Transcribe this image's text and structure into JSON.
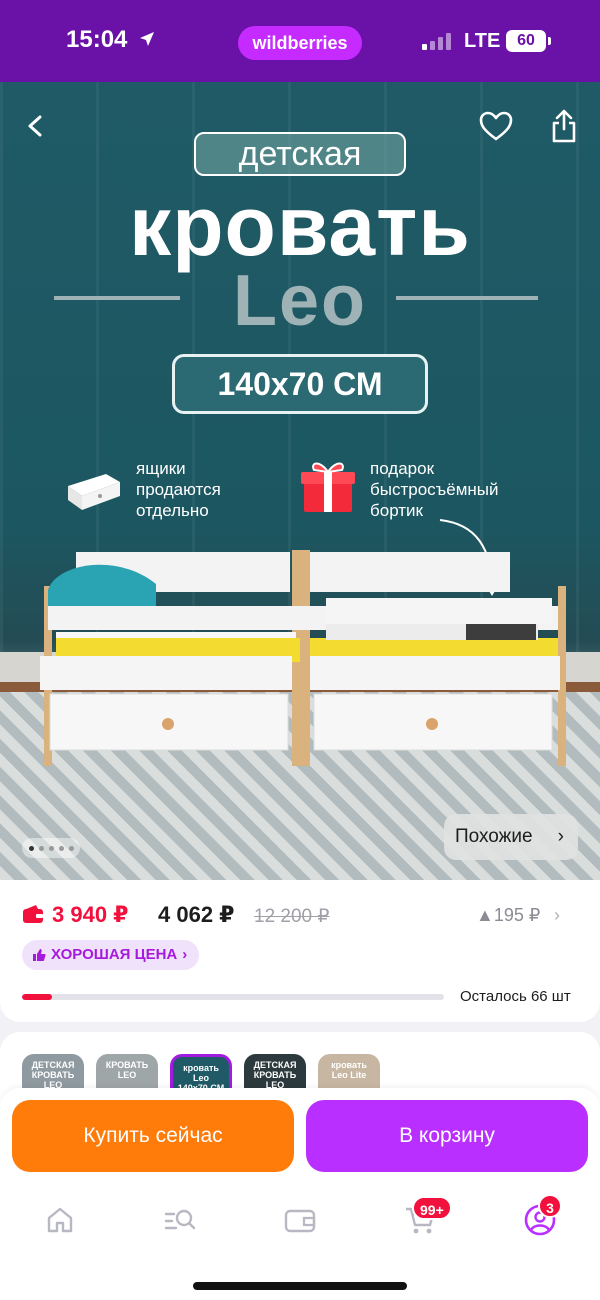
{
  "status_bar": {
    "time": "15:04",
    "brand": "wildberries",
    "network": "LTE",
    "battery": "60"
  },
  "hero": {
    "label_top": "детская",
    "title": "кровать",
    "model": "Leo",
    "size": "140х70 СМ",
    "note_drawers": [
      "ящики",
      "продаются",
      "отдельно"
    ],
    "note_gift": [
      "подарок",
      "быстросъёмный",
      "бортик"
    ],
    "similar_button": "Похожие",
    "carousel": {
      "count": 5,
      "active_index": 0
    }
  },
  "icons": {
    "back": "chevron-left-icon",
    "favorite": "heart-icon",
    "share": "share-icon",
    "wallet": "wallet-icon",
    "like": "thumbs-up-icon"
  },
  "price": {
    "wallet_price": "3 940 ₽",
    "price": "4 062 ₽",
    "old_price": "12 200 ₽",
    "rank": "▲195 ₽",
    "good_price_label": "ХОРОШАЯ ЦЕНА",
    "stock_text": "Осталось 66 шт",
    "stock_fraction": 0.07
  },
  "variants": [
    {
      "lines": [
        "ДЕТСКАЯ",
        "КРОВАТЬ",
        "LEO"
      ],
      "color": "#8f9aa0",
      "selected": false
    },
    {
      "lines": [
        "КРОВАТЬ",
        "LEO"
      ],
      "color": "#9fa6a8",
      "selected": false
    },
    {
      "lines": [
        "кровать",
        "Leo",
        "140х70 СМ"
      ],
      "color": "#1f5a66",
      "selected": true
    },
    {
      "lines": [
        "ДЕТСКАЯ",
        "КРОВАТЬ",
        "LEO"
      ],
      "color": "#2d3a3d",
      "selected": false
    },
    {
      "lines": [
        "кровать",
        "Leo Lite"
      ],
      "color": "#c7b6a2",
      "selected": false
    }
  ],
  "actions": {
    "buy_now": "Купить сейчас",
    "add_to_cart": "В корзину"
  },
  "tabbar": {
    "cart_badge": "99+",
    "profile_badge": "3"
  },
  "colors": {
    "brand_purple": "#6a11a8",
    "sale_red": "#f1113c",
    "buy_orange": "#ff7c0b",
    "cart_purple": "#b82fff"
  }
}
